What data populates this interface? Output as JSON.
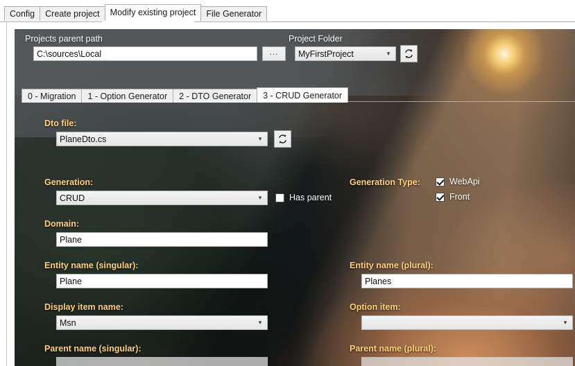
{
  "window": {
    "outer_tabs": [
      {
        "label": "Config",
        "active": false
      },
      {
        "label": "Create project",
        "active": false
      },
      {
        "label": "Modify existing project",
        "active": true
      },
      {
        "label": "File Generator",
        "active": false
      }
    ]
  },
  "header": {
    "parent_path_label": "Projects parent path",
    "parent_path_value": "C:\\sources\\Local",
    "browse_button_label": "...",
    "project_folder_label": "Project Folder",
    "project_folder_value": "MyFirstProject",
    "project_folder_refresh_icon": "refresh-icon"
  },
  "inner_tabs": [
    {
      "label": "0 - Migration",
      "active": false
    },
    {
      "label": "1 - Option Generator",
      "active": false
    },
    {
      "label": "2 - DTO Generator",
      "active": false
    },
    {
      "label": "3 - CRUD Generator",
      "active": true
    }
  ],
  "form": {
    "dto_file": {
      "label": "Dto file:",
      "value": "PlaneDto.cs",
      "refresh_icon": "refresh-icon"
    },
    "generation": {
      "label": "Generation:",
      "value": "CRUD"
    },
    "has_parent": {
      "label": "Has parent",
      "checked": false
    },
    "generation_type": {
      "label": "Generation Type:",
      "options": [
        {
          "label": "WebApi",
          "checked": true
        },
        {
          "label": "Front",
          "checked": true
        }
      ]
    },
    "domain": {
      "label": "Domain:",
      "value": "Plane"
    },
    "entity_singular": {
      "label": "Entity name (singular):",
      "value": "Plane"
    },
    "entity_plural": {
      "label": "Entity name (plural):",
      "value": "Planes"
    },
    "display_item_name": {
      "label": "Display item name:",
      "value": "Msn"
    },
    "option_item": {
      "label": "Option item:",
      "value": ""
    },
    "parent_singular": {
      "label": "Parent name (singular):",
      "value": "",
      "disabled": true
    },
    "parent_plural": {
      "label": "Parent name (plural):",
      "value": "",
      "disabled": true
    }
  },
  "colors": {
    "label_gold": "#ffd07a",
    "tab_active_bg": "#ffffff",
    "tab_inactive_bg": "#f0f0f0",
    "panel_overlay": "#54585a"
  }
}
